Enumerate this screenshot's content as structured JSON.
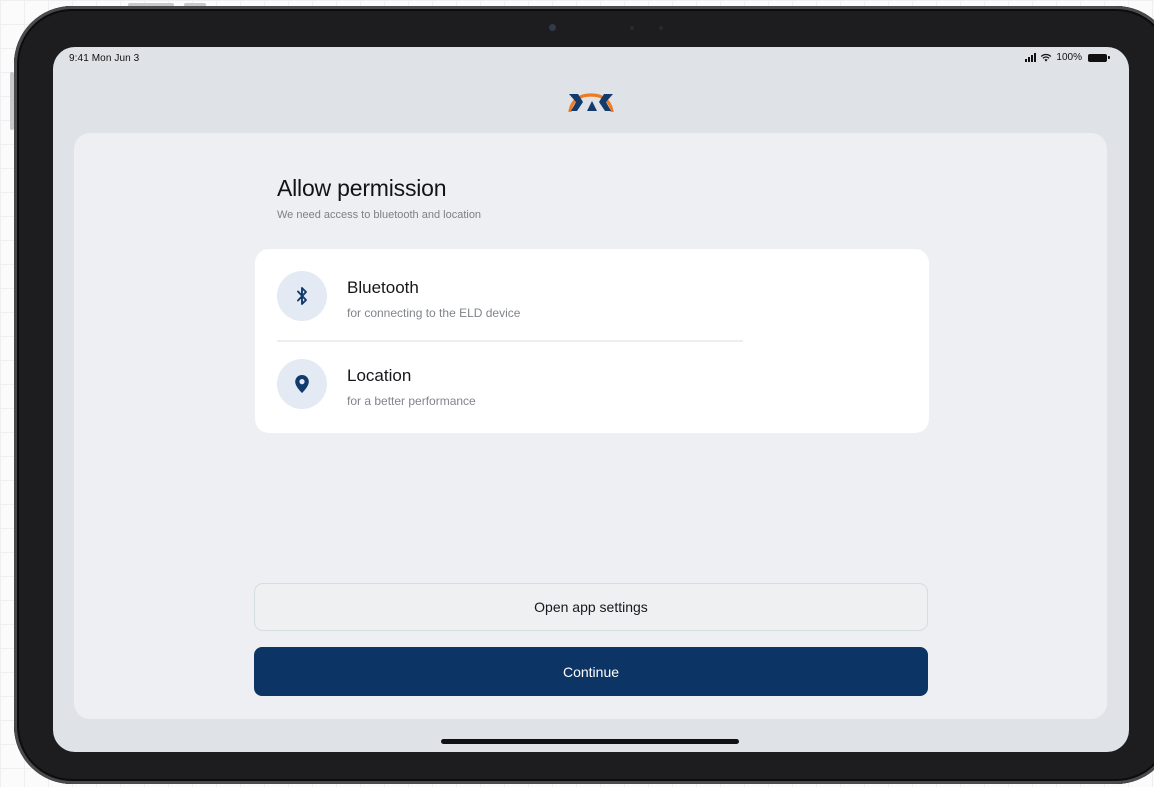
{
  "status_bar": {
    "time": "9:41 Mon Jun 3",
    "battery": "100%"
  },
  "page": {
    "title": "Allow permission",
    "subtitle": "We need access to bluetooth and location"
  },
  "permissions": [
    {
      "icon": "bluetooth-icon",
      "title": "Bluetooth",
      "description": "for connecting to the ELD device"
    },
    {
      "icon": "location-pin-icon",
      "title": "Location",
      "description": "for a better performance"
    }
  ],
  "actions": {
    "open_settings_label": "Open app settings",
    "continue_label": "Continue"
  },
  "colors": {
    "primary": "#0c3566",
    "logo_navy": "#123a6b",
    "logo_orange": "#f07a22",
    "icon_bg": "#e3eaf4"
  }
}
